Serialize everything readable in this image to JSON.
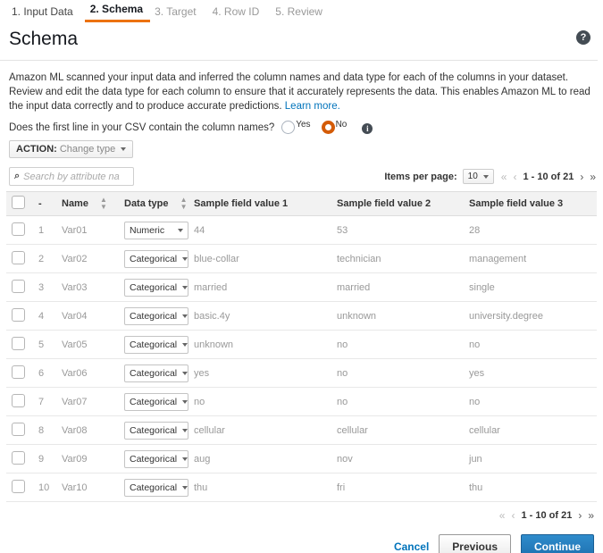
{
  "wizard": {
    "steps": [
      {
        "label": "1. Input Data",
        "state": "done"
      },
      {
        "label": "2. Schema",
        "state": "active"
      },
      {
        "label": "3. Target",
        "state": "upcoming"
      },
      {
        "label": "4. Row ID",
        "state": "upcoming"
      },
      {
        "label": "5. Review",
        "state": "upcoming"
      }
    ]
  },
  "header": {
    "title": "Schema",
    "help_icon": "question-mark-icon",
    "help_glyph": "?"
  },
  "description": {
    "text": "Amazon ML scanned your input data and inferred the column names and data type for each of the columns in your dataset. Review and edit the data type for each column to ensure that it accurately represents the data. This enables Amazon ML to read the input data correctly and to produce accurate predictions.",
    "link_label": "Learn more."
  },
  "csv_question": {
    "label": "Does the first line in your CSV contain the column names?",
    "options": [
      {
        "label": "Yes",
        "selected": false
      },
      {
        "label": "No",
        "selected": true
      }
    ],
    "info_glyph": "i",
    "selected_color": "#d45b07"
  },
  "action_menu": {
    "prefix": "ACTION:",
    "value": "Change type"
  },
  "search": {
    "placeholder": "Search by attribute name",
    "value": "",
    "icon": "search-icon",
    "icon_glyph": "⌕"
  },
  "pagination": {
    "items_per_page_label": "Items per page:",
    "items_per_page_value": "10",
    "range_text": "1 - 10 of 21",
    "first_glyph": "«",
    "prev_glyph": "‹",
    "next_glyph": "›",
    "last_glyph": "»"
  },
  "table": {
    "columns": [
      {
        "key": "check",
        "label": ""
      },
      {
        "key": "idx",
        "label": "-"
      },
      {
        "key": "name",
        "label": "Name",
        "sortable": true
      },
      {
        "key": "type",
        "label": "Data type",
        "sortable": true
      },
      {
        "key": "s1",
        "label": "Sample field value 1"
      },
      {
        "key": "s2",
        "label": "Sample field value 2"
      },
      {
        "key": "s3",
        "label": "Sample field value 3"
      }
    ],
    "rows": [
      {
        "idx": "1",
        "name": "Var01",
        "type": "Numeric",
        "s1": "44",
        "s2": "53",
        "s3": "28"
      },
      {
        "idx": "2",
        "name": "Var02",
        "type": "Categorical",
        "s1": "blue-collar",
        "s2": "technician",
        "s3": "management"
      },
      {
        "idx": "3",
        "name": "Var03",
        "type": "Categorical",
        "s1": "married",
        "s2": "married",
        "s3": "single"
      },
      {
        "idx": "4",
        "name": "Var04",
        "type": "Categorical",
        "s1": "basic.4y",
        "s2": "unknown",
        "s3": "university.degree"
      },
      {
        "idx": "5",
        "name": "Var05",
        "type": "Categorical",
        "s1": "unknown",
        "s2": "no",
        "s3": "no"
      },
      {
        "idx": "6",
        "name": "Var06",
        "type": "Categorical",
        "s1": "yes",
        "s2": "no",
        "s3": "yes"
      },
      {
        "idx": "7",
        "name": "Var07",
        "type": "Categorical",
        "s1": "no",
        "s2": "no",
        "s3": "no"
      },
      {
        "idx": "8",
        "name": "Var08",
        "type": "Categorical",
        "s1": "cellular",
        "s2": "cellular",
        "s3": "cellular"
      },
      {
        "idx": "9",
        "name": "Var09",
        "type": "Categorical",
        "s1": "aug",
        "s2": "nov",
        "s3": "jun"
      },
      {
        "idx": "10",
        "name": "Var10",
        "type": "Categorical",
        "s1": "thu",
        "s2": "fri",
        "s3": "thu"
      }
    ]
  },
  "footer": {
    "cancel_label": "Cancel",
    "previous_label": "Previous",
    "continue_label": "Continue",
    "primary_color": "#1d6fae"
  }
}
